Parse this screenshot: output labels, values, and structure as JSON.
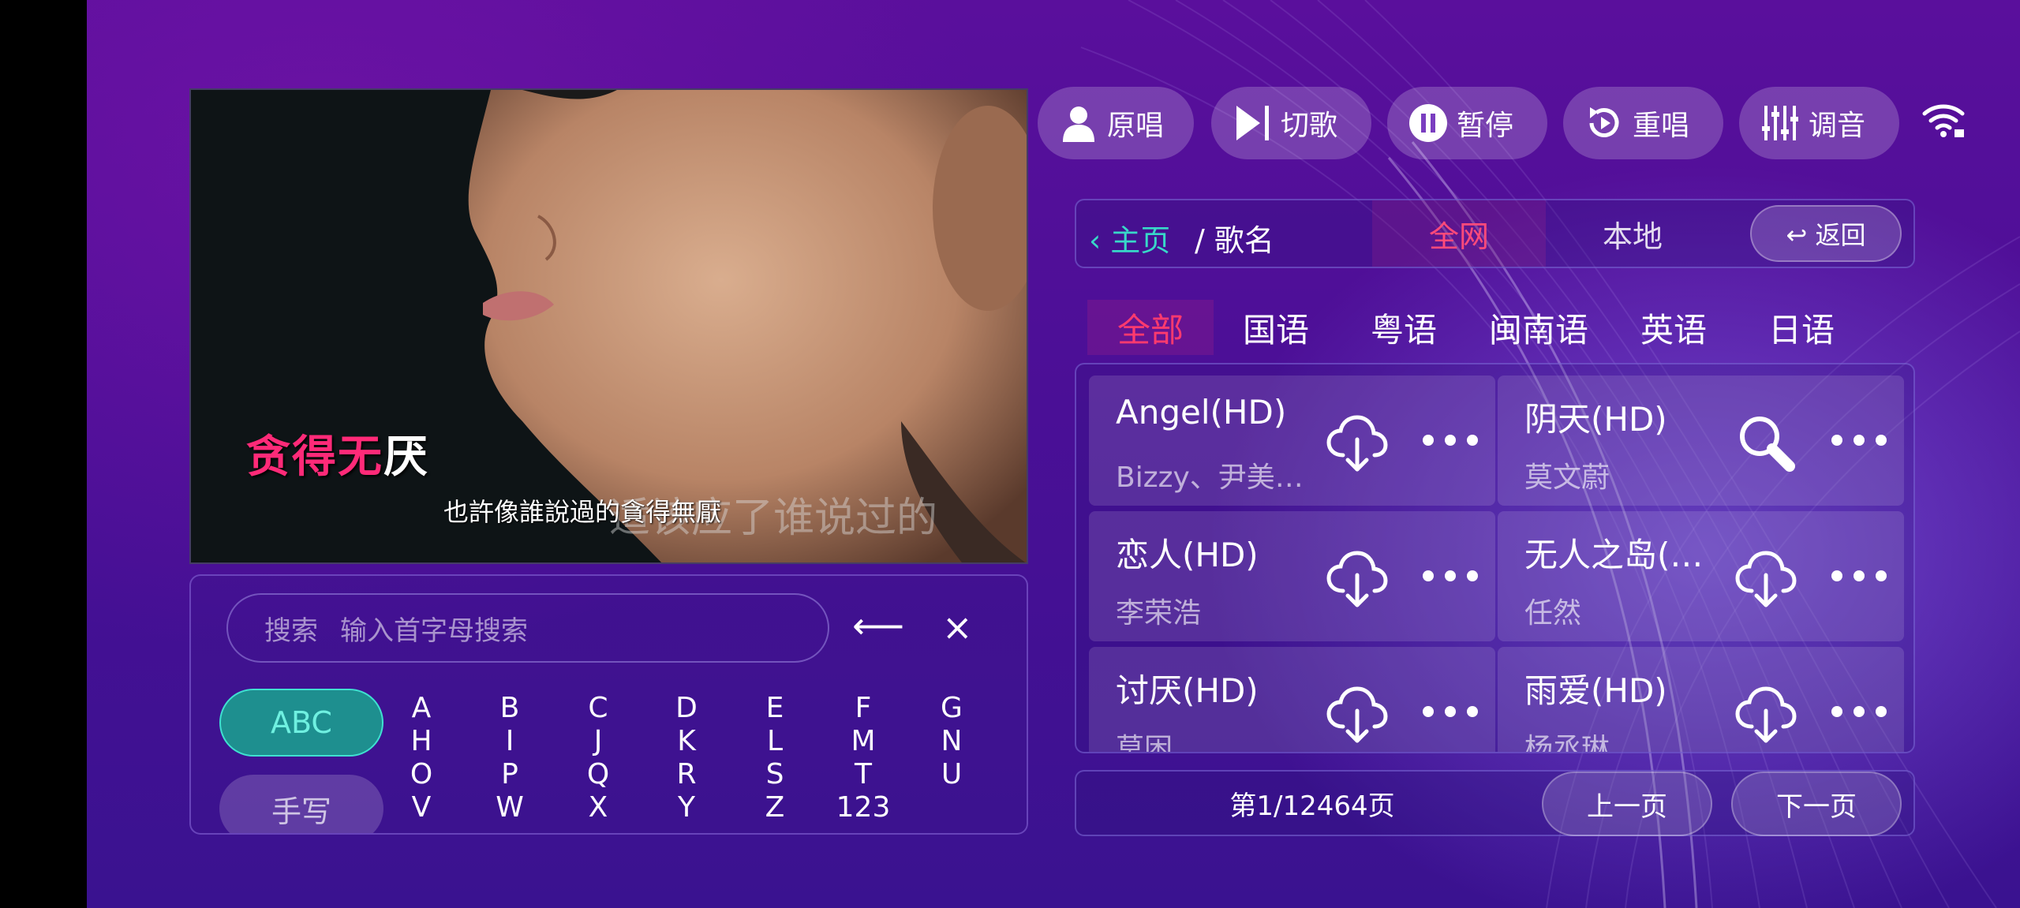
{
  "player": {
    "lyric_sung": "贪得无",
    "lyric_unsung": "厌",
    "subtitle": "也許像誰說過的貪得無厭",
    "ghost_lyric": "适该应了谁说过的"
  },
  "search": {
    "label": "搜索",
    "placeholder": "输入首字母搜索",
    "backspace": "⟵",
    "clear": "×"
  },
  "keyboard": {
    "modes": [
      "ABC",
      "手写"
    ],
    "keys": [
      "A",
      "B",
      "C",
      "D",
      "E",
      "F",
      "G",
      "H",
      "I",
      "J",
      "K",
      "L",
      "M",
      "N",
      "O",
      "P",
      "Q",
      "R",
      "S",
      "T",
      "U",
      "V",
      "W",
      "X",
      "Y",
      "Z",
      "123"
    ]
  },
  "controls": [
    {
      "label": "原唱",
      "icon": "user-icon"
    },
    {
      "label": "切歌",
      "icon": "skip-next-icon"
    },
    {
      "label": "暂停",
      "icon": "pause-icon"
    },
    {
      "label": "重唱",
      "icon": "replay-icon"
    },
    {
      "label": "调音",
      "icon": "equalizer-icon"
    }
  ],
  "breadcrumb": {
    "home": "‹ 主页",
    "current": "/ 歌名"
  },
  "source_tabs": [
    "全网",
    "本地"
  ],
  "back_label": "↩ 返回",
  "language_tabs": [
    "全部",
    "国语",
    "粤语",
    "闽南语",
    "英语",
    "日语"
  ],
  "songs": [
    {
      "title": "Angel(HD)",
      "artist": "Bizzy、尹美…",
      "icon": "cloud-download-icon"
    },
    {
      "title": "阴天(HD)",
      "artist": "莫文蔚",
      "icon": "search-icon"
    },
    {
      "title": "恋人(HD)",
      "artist": "李荣浩",
      "icon": "cloud-download-icon"
    },
    {
      "title": "无人之岛(…",
      "artist": "任然",
      "icon": "cloud-download-icon"
    },
    {
      "title": "讨厌(HD)",
      "artist": "莫困",
      "icon": "cloud-download-icon"
    },
    {
      "title": "雨爱(HD)",
      "artist": "杨丞琳",
      "icon": "cloud-download-icon"
    }
  ],
  "pagination": {
    "info": "第1/12464页",
    "prev": "上一页",
    "next": "下一页"
  },
  "colors": {
    "accent_red": "#ff3a6e",
    "accent_teal": "#38d8c8",
    "lyric_pink": "#ff2a78"
  }
}
